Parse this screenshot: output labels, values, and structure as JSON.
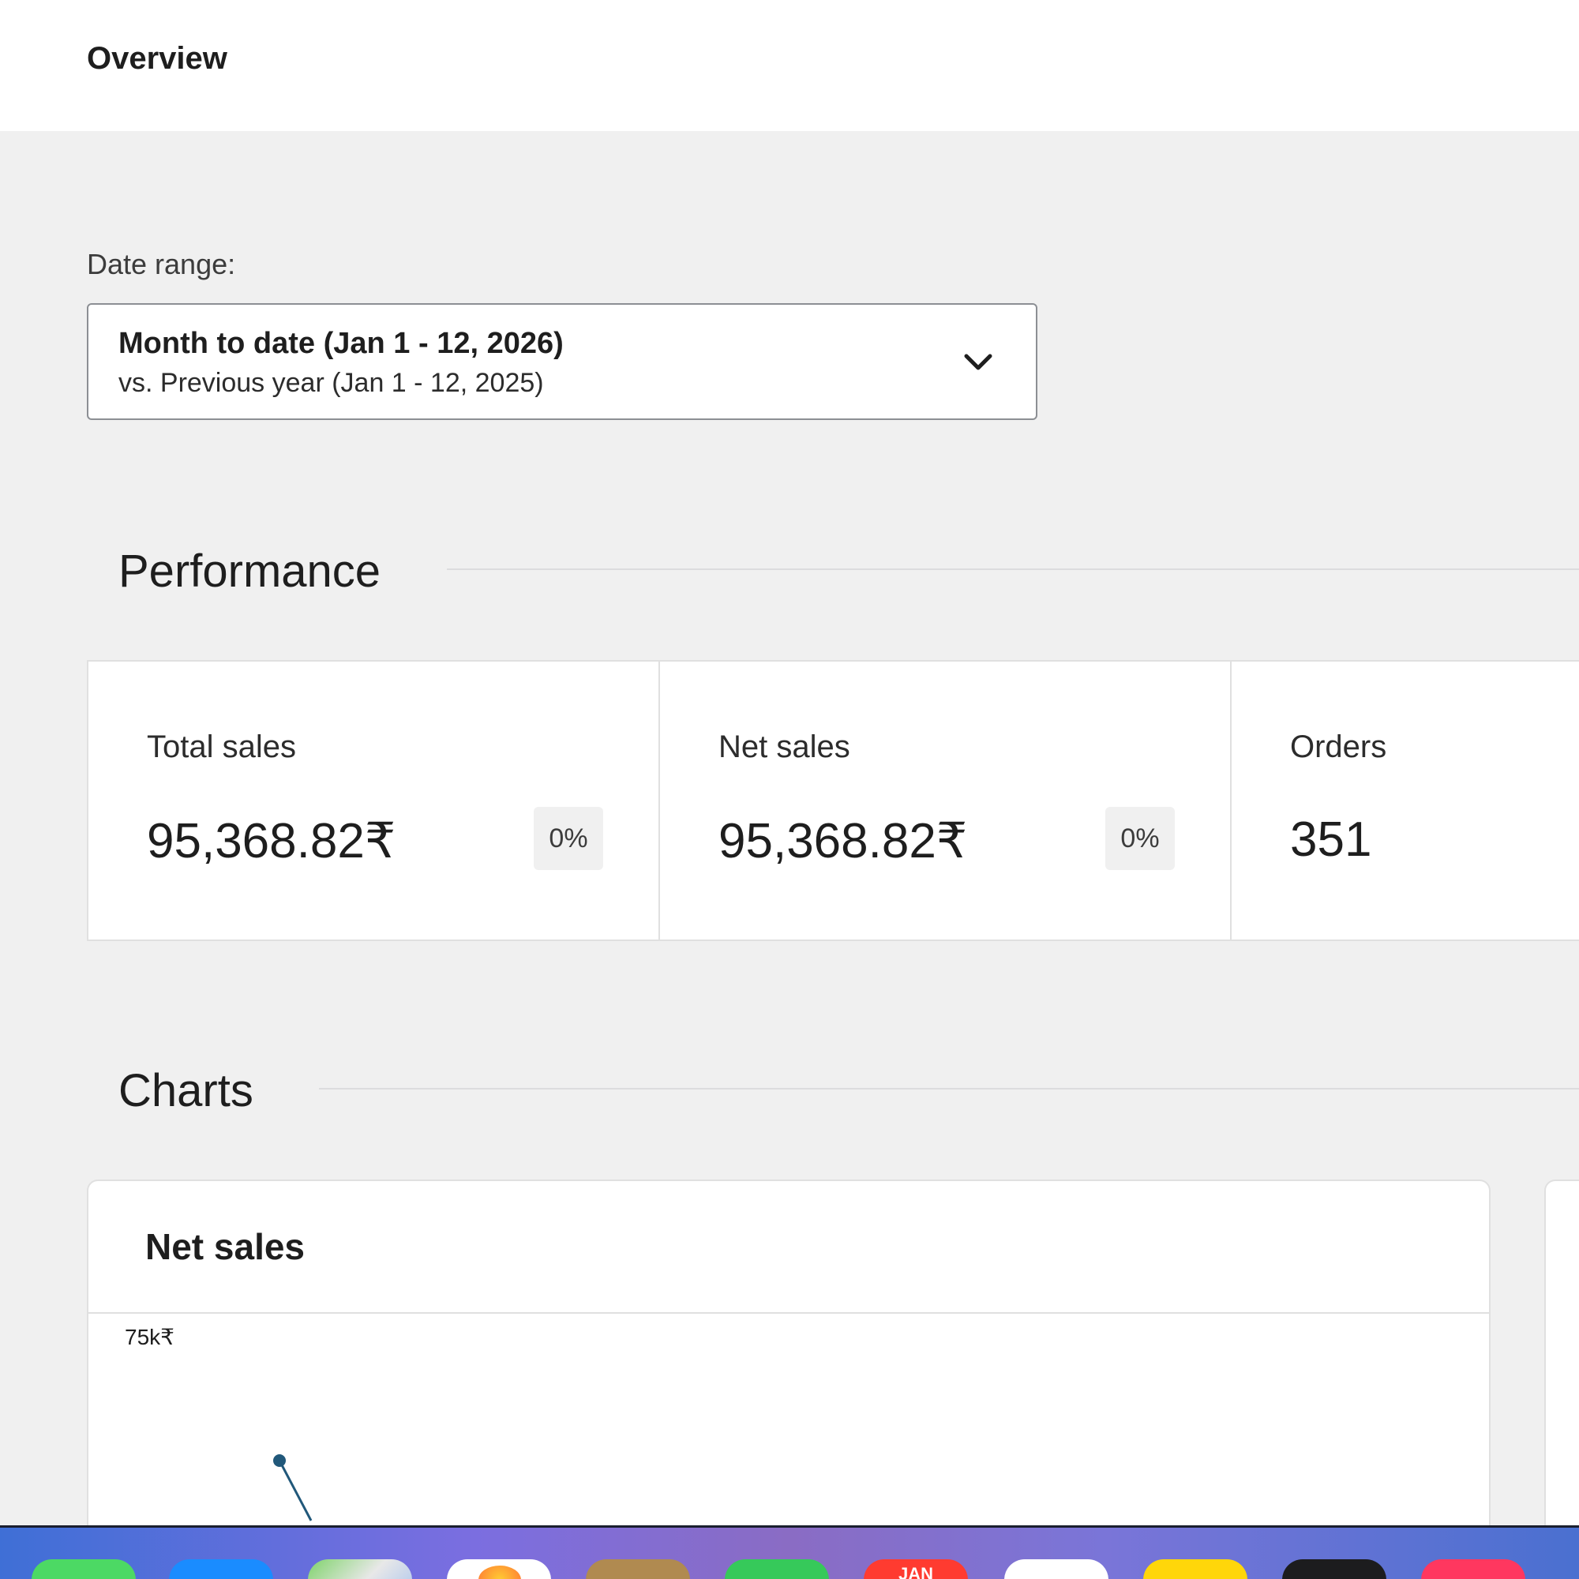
{
  "header": {
    "title": "Overview"
  },
  "date_range": {
    "label": "Date range:",
    "primary": "Month to date (Jan 1 - 12, 2026)",
    "secondary": "vs. Previous year (Jan 1 - 12, 2025)"
  },
  "performance": {
    "title": "Performance",
    "cards": [
      {
        "label": "Total sales",
        "value": "95,368.82₹",
        "delta": "0%"
      },
      {
        "label": "Net sales",
        "value": "95,368.82₹",
        "delta": "0%"
      },
      {
        "label": "Orders",
        "value": "351"
      }
    ]
  },
  "charts": {
    "title": "Charts",
    "net_sales": {
      "title": "Net sales",
      "y_tick": "75k₹"
    }
  },
  "dock": {
    "calendar_month": "JAN",
    "icons": [
      "messages-icon",
      "app-store-icon",
      "maps-icon",
      "photos-icon",
      "contacts-icon",
      "facetime-icon",
      "calendar-icon",
      "reminders-icon",
      "notes-icon",
      "tv-icon",
      "music-icon"
    ]
  },
  "colors": {
    "accent": "#21587a",
    "background": "#f0f0f0",
    "card": "#ffffff"
  }
}
